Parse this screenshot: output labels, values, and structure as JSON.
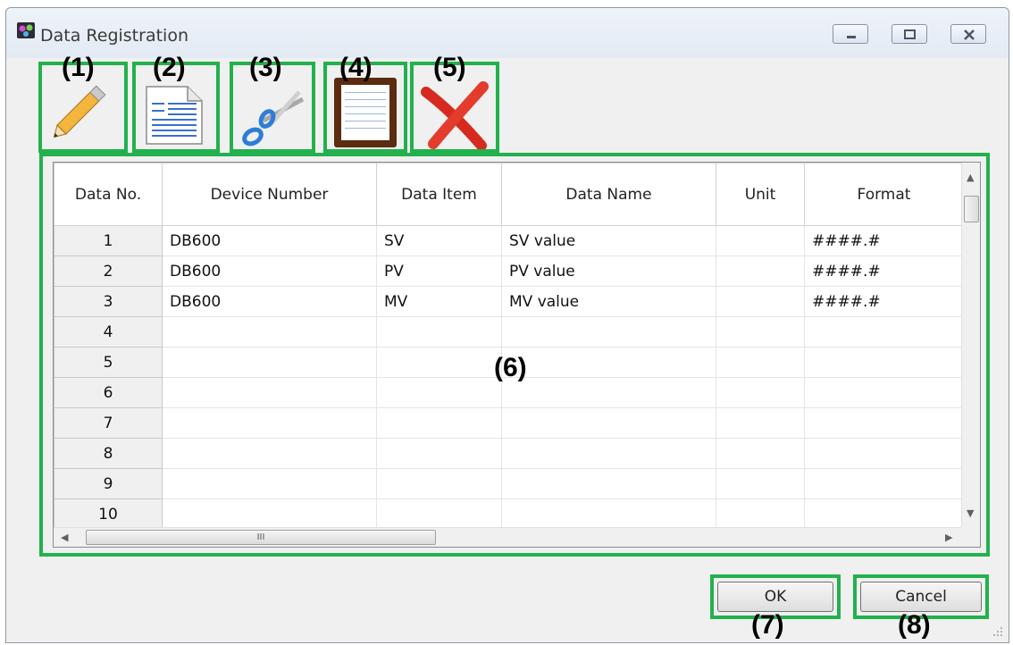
{
  "window": {
    "title": "Data Registration"
  },
  "callouts": {
    "c1": "(1)",
    "c2": "(2)",
    "c3": "(3)",
    "c4": "(4)",
    "c5": "(5)",
    "c6": "(6)",
    "c7": "(7)",
    "c8": "(8)"
  },
  "toolbar": {
    "items": [
      {
        "icon": "pencil-icon"
      },
      {
        "icon": "document-icon"
      },
      {
        "icon": "scissors-icon"
      },
      {
        "icon": "clipboard-icon"
      },
      {
        "icon": "delete-x-icon"
      }
    ]
  },
  "grid": {
    "columns": [
      "Data No.",
      "Device Number",
      "Data Item",
      "Data Name",
      "Unit",
      "Format"
    ],
    "rows": [
      {
        "no": "1",
        "device": "DB600",
        "item": "SV",
        "name": "SV value",
        "unit": "",
        "format": "####.#"
      },
      {
        "no": "2",
        "device": "DB600",
        "item": "PV",
        "name": "PV value",
        "unit": "",
        "format": "####.#"
      },
      {
        "no": "3",
        "device": "DB600",
        "item": "MV",
        "name": "MV value",
        "unit": "",
        "format": "####.#"
      },
      {
        "no": "4",
        "device": "",
        "item": "",
        "name": "",
        "unit": "",
        "format": ""
      },
      {
        "no": "5",
        "device": "",
        "item": "",
        "name": "",
        "unit": "",
        "format": ""
      },
      {
        "no": "6",
        "device": "",
        "item": "",
        "name": "",
        "unit": "",
        "format": ""
      },
      {
        "no": "7",
        "device": "",
        "item": "",
        "name": "",
        "unit": "",
        "format": ""
      },
      {
        "no": "8",
        "device": "",
        "item": "",
        "name": "",
        "unit": "",
        "format": ""
      },
      {
        "no": "9",
        "device": "",
        "item": "",
        "name": "",
        "unit": "",
        "format": ""
      },
      {
        "no": "10",
        "device": "",
        "item": "",
        "name": "",
        "unit": "",
        "format": ""
      }
    ],
    "hscroll_grip": "III"
  },
  "buttons": {
    "ok": "OK",
    "cancel": "Cancel"
  },
  "colors": {
    "highlight": "#22b14c"
  }
}
